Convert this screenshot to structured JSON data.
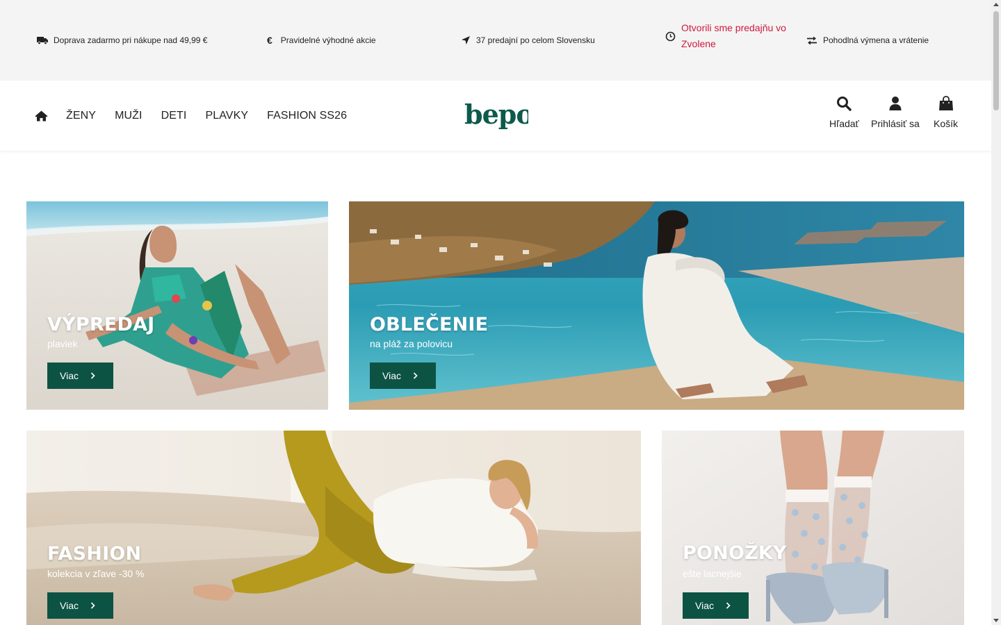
{
  "infobar": {
    "shipping": "Doprava zadarmo pri nákupe nad 49,99 €",
    "promos": "Pravidelné výhodné akcie",
    "stores": "37 predajní po celom Slovensku",
    "opening": "Otvorili sme predajňu vo Zvolene",
    "returns": "Pohodlná výmena a vrátenie",
    "alert_color": "#d0193e"
  },
  "nav": {
    "items": [
      "ŽENY",
      "MUŽI",
      "DETI",
      "PLAVKY",
      "FASHION SS26"
    ]
  },
  "logo": {
    "text": "bepon",
    "color": "#0d5a4c"
  },
  "header_actions": {
    "search": "Hľadať",
    "login": "Prihlásiť sa",
    "cart": "Košík"
  },
  "banners": [
    {
      "title": "VÝPREDAJ",
      "subtitle": "plaviek",
      "button": "Viac"
    },
    {
      "title": "OBLEČENIE",
      "subtitle": "na pláž za polovicu",
      "button": "Viac"
    },
    {
      "title": "FASHION",
      "subtitle": "kolekcia v zľave -30 %",
      "button": "Viac"
    },
    {
      "title": "PONOŽKY",
      "subtitle": "ešte lacnejšie",
      "button": "Viac"
    }
  ],
  "colors": {
    "button_bg": "#0d5344",
    "infobar_bg": "#f4f4f4"
  }
}
